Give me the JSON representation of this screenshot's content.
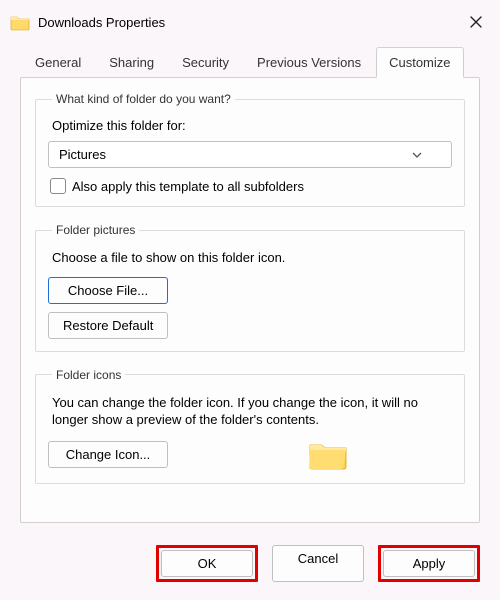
{
  "window": {
    "title": "Downloads Properties"
  },
  "tabs": {
    "general": "General",
    "sharing": "Sharing",
    "security": "Security",
    "previous": "Previous Versions",
    "customize": "Customize"
  },
  "optimize": {
    "legend": "What kind of folder do you want?",
    "label": "Optimize this folder for:",
    "selected": "Pictures",
    "subfolders": "Also apply this template to all subfolders"
  },
  "folderpics": {
    "legend": "Folder pictures",
    "desc": "Choose a file to show on this folder icon.",
    "choose": "Choose File...",
    "restore": "Restore Default"
  },
  "foldericons": {
    "legend": "Folder icons",
    "desc": "You can change the folder icon. If you change the icon, it will no longer show a preview of the folder's contents.",
    "change": "Change Icon..."
  },
  "dialog": {
    "ok": "OK",
    "cancel": "Cancel",
    "apply": "Apply"
  }
}
